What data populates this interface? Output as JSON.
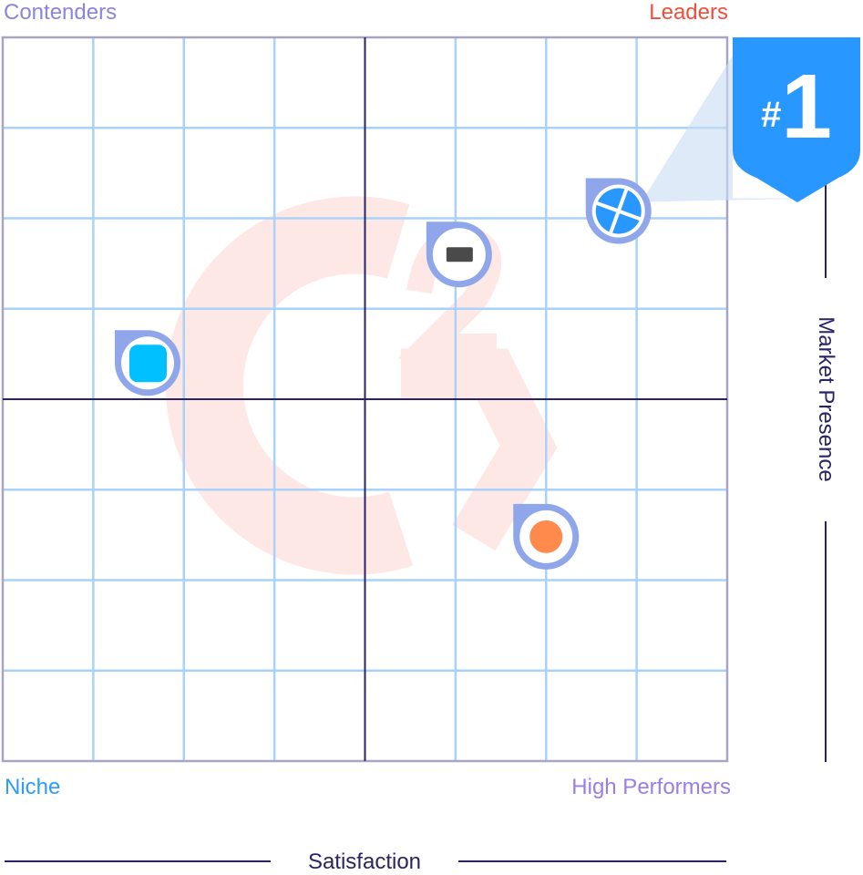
{
  "quadrants": {
    "top_left": "Contenders",
    "top_right": "Leaders",
    "bottom_left": "Niche",
    "bottom_right": "High Performers"
  },
  "colors": {
    "contenders": "#8b84e0",
    "leaders": "#ef4f3a",
    "niche": "#2b9dfd",
    "high_performers": "#9b7de8",
    "grid": "#a9d2fb",
    "axis": "#2a2466",
    "badge": "#2897ff",
    "marker_ring": "#8fa7ea",
    "watermark": "#fde8e5"
  },
  "badge": {
    "text": "#1"
  },
  "chart_data": {
    "type": "scatter",
    "xlabel": "Satisfaction",
    "ylabel": "Market Presence",
    "xlim": [
      0,
      1
    ],
    "ylim": [
      0,
      1
    ],
    "grid": true,
    "points": [
      {
        "icon": "blue-fan-logo",
        "color": "#2897ff",
        "x": 0.85,
        "y": 0.76,
        "ranked": true
      },
      {
        "icon": "gray-bar-logo",
        "color": "#4a4a4a",
        "x": 0.63,
        "y": 0.7
      },
      {
        "icon": "cyan-square-logo",
        "color": "#00c0ff",
        "x": 0.2,
        "y": 0.55
      },
      {
        "icon": "orange-dot-logo",
        "color": "#ff8a4c",
        "x": 0.75,
        "y": 0.31
      }
    ]
  }
}
